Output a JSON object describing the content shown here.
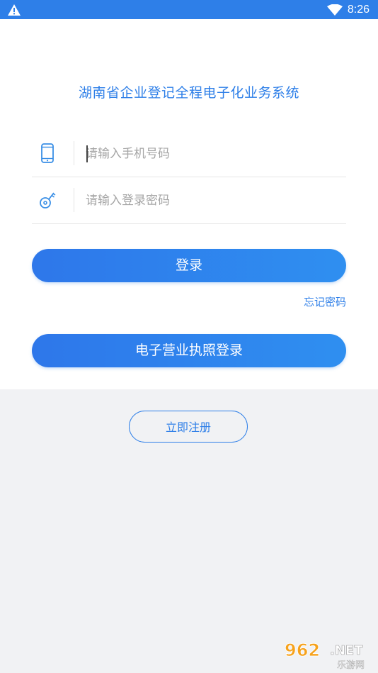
{
  "status_bar": {
    "time": "8:26"
  },
  "app": {
    "title": "湖南省企业登记全程电子化业务系统"
  },
  "phone_field": {
    "placeholder": "请输入手机号码",
    "value": ""
  },
  "password_field": {
    "placeholder": "请输入登录密码",
    "value": ""
  },
  "login_button": {
    "label": "登录"
  },
  "forgot_link": {
    "label": "忘记密码"
  },
  "license_login_button": {
    "label": "电子营业执照登录"
  },
  "register_button": {
    "label": "立即注册"
  },
  "watermark": {
    "brand": "962.NET",
    "sub": "乐游网"
  },
  "colors": {
    "accent": "#2e7fe8",
    "background": "#f1f2f4",
    "card": "#ffffff"
  }
}
